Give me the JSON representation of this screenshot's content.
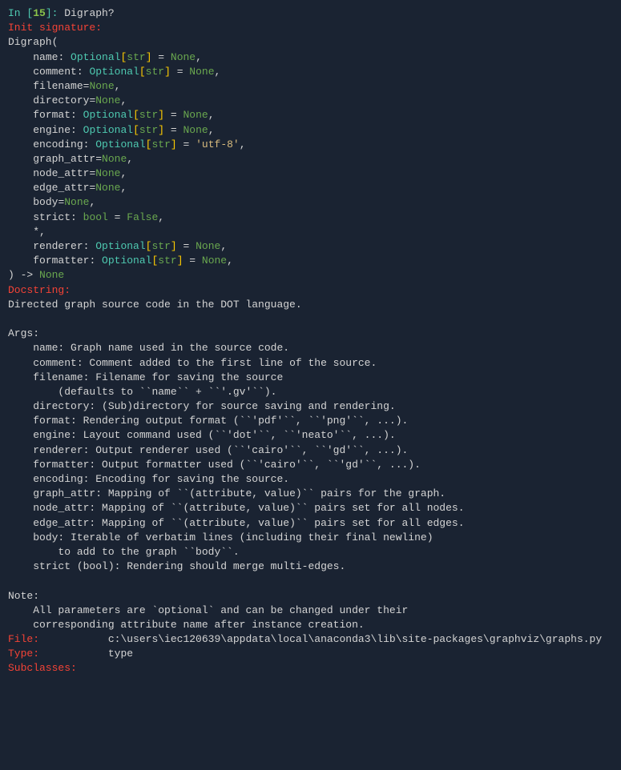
{
  "prompt": {
    "in": "In ",
    "num": "15",
    "query": "Digraph?"
  },
  "headers": {
    "init_sig": "Init signature:",
    "docstring": "Docstring:",
    "file": "File:",
    "type": "Type:",
    "subclasses": "Subclasses:"
  },
  "sig": {
    "class_name": "Digraph",
    "optional": "Optional",
    "str": "str",
    "bool": "bool",
    "none": "None",
    "false": "False",
    "star": "*,",
    "params": [
      {
        "name": "name"
      },
      {
        "name": "comment"
      },
      {
        "name": "filename"
      },
      {
        "name": "directory"
      },
      {
        "name": "format"
      },
      {
        "name": "engine"
      },
      {
        "name": "encoding",
        "default": "'utf-8'"
      },
      {
        "name": "graph_attr"
      },
      {
        "name": "node_attr"
      },
      {
        "name": "edge_attr"
      },
      {
        "name": "body"
      },
      {
        "name": "strict"
      },
      {
        "name": "renderer"
      },
      {
        "name": "formatter"
      }
    ]
  },
  "doc": {
    "summary": "Directed graph source code in the DOT language.",
    "args_header": "Args:",
    "args": [
      "name: Graph name used in the source code.",
      "comment: Comment added to the first line of the source.",
      "filename: Filename for saving the source",
      "(defaults to ``name`` + ``'.gv'``).",
      "directory: (Sub)directory for source saving and rendering.",
      "format: Rendering output format (``'pdf'``, ``'png'``, ...).",
      "engine: Layout command used (``'dot'``, ``'neato'``, ...).",
      "renderer: Output renderer used (``'cairo'``, ``'gd'``, ...).",
      "formatter: Output formatter used (``'cairo'``, ``'gd'``, ...).",
      "encoding: Encoding for saving the source.",
      "graph_attr: Mapping of ``(attribute, value)`` pairs for the graph.",
      "node_attr: Mapping of ``(attribute, value)`` pairs set for all nodes.",
      "edge_attr: Mapping of ``(attribute, value)`` pairs set for all edges.",
      "body: Iterable of verbatim lines (including their final newline)",
      "to add to the graph ``body``.",
      "strict (bool): Rendering should merge multi-edges."
    ],
    "note_header": "Note:",
    "note": [
      "All parameters are `optional` and can be changed under their",
      "corresponding attribute name after instance creation."
    ]
  },
  "meta": {
    "file": "c:\\users\\iec120639\\appdata\\local\\anaconda3\\lib\\site-packages\\graphviz\\graphs.py",
    "type": "type"
  }
}
